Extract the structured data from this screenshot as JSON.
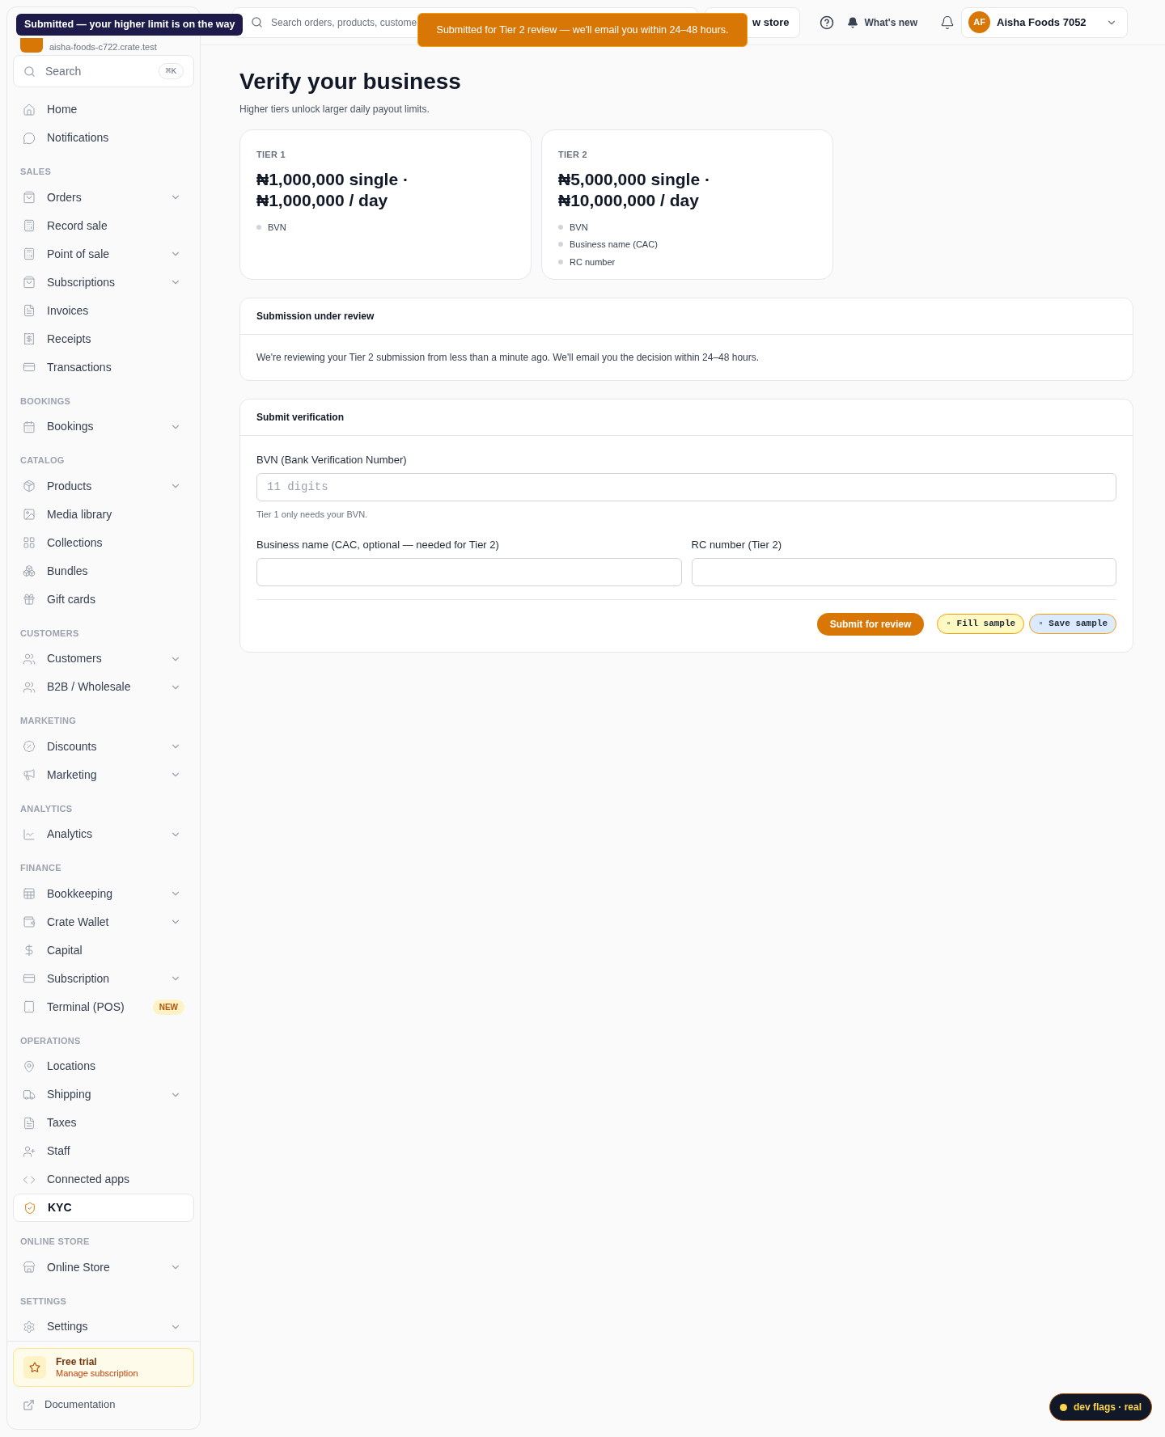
{
  "sidebar": {
    "store_url": "aisha-foods-c722.crate.test",
    "search": {
      "placeholder": "Search",
      "shortcut": "⌘K"
    },
    "sections": [
      {
        "items": [
          {
            "label": "Home",
            "expandable": false,
            "selected": false
          },
          {
            "label": "Notifications",
            "expandable": false,
            "selected": false
          }
        ]
      },
      {
        "title": "SALES",
        "items": [
          {
            "label": "Orders",
            "expandable": true,
            "selected": false
          },
          {
            "label": "Record sale",
            "expandable": false,
            "selected": false
          },
          {
            "label": "Point of sale",
            "expandable": true,
            "selected": false
          },
          {
            "label": "Subscriptions",
            "expandable": true,
            "selected": false
          },
          {
            "label": "Invoices",
            "expandable": false,
            "selected": false
          },
          {
            "label": "Receipts",
            "expandable": false,
            "selected": false
          },
          {
            "label": "Transactions",
            "expandable": false,
            "selected": false
          }
        ]
      },
      {
        "title": "BOOKINGS",
        "items": [
          {
            "label": "Bookings",
            "expandable": true,
            "selected": false
          }
        ]
      },
      {
        "title": "CATALOG",
        "items": [
          {
            "label": "Products",
            "expandable": true,
            "selected": false
          },
          {
            "label": "Media library",
            "expandable": false,
            "selected": false
          },
          {
            "label": "Collections",
            "expandable": false,
            "selected": false
          },
          {
            "label": "Bundles",
            "expandable": false,
            "selected": false
          },
          {
            "label": "Gift cards",
            "expandable": false,
            "selected": false
          }
        ]
      },
      {
        "title": "CUSTOMERS",
        "items": [
          {
            "label": "Customers",
            "expandable": true,
            "selected": false
          },
          {
            "label": "B2B / Wholesale",
            "expandable": true,
            "selected": false
          }
        ]
      },
      {
        "title": "MARKETING",
        "items": [
          {
            "label": "Discounts",
            "expandable": true,
            "selected": false
          },
          {
            "label": "Marketing",
            "expandable": true,
            "selected": false
          }
        ]
      },
      {
        "title": "ANALYTICS",
        "items": [
          {
            "label": "Analytics",
            "expandable": true,
            "selected": false
          }
        ]
      },
      {
        "title": "FINANCE",
        "items": [
          {
            "label": "Bookkeeping",
            "expandable": true,
            "selected": false
          },
          {
            "label": "Crate Wallet",
            "expandable": true,
            "selected": false
          },
          {
            "label": "Capital",
            "expandable": false,
            "selected": false
          },
          {
            "label": "Subscription",
            "expandable": true,
            "selected": false
          },
          {
            "label": "Terminal (POS)",
            "expandable": false,
            "selected": false,
            "badge": "NEW"
          }
        ]
      },
      {
        "title": "OPERATIONS",
        "items": [
          {
            "label": "Locations",
            "expandable": false,
            "selected": false
          },
          {
            "label": "Shipping",
            "expandable": true,
            "selected": false
          },
          {
            "label": "Taxes",
            "expandable": false,
            "selected": false
          },
          {
            "label": "Staff",
            "expandable": false,
            "selected": false
          },
          {
            "label": "Connected apps",
            "expandable": false,
            "selected": false
          },
          {
            "label": "KYC",
            "expandable": false,
            "selected": true
          }
        ]
      },
      {
        "title": "ONLINE STORE",
        "items": [
          {
            "label": "Online Store",
            "expandable": true,
            "selected": false
          }
        ]
      },
      {
        "title": "SETTINGS",
        "items": [
          {
            "label": "Settings",
            "expandable": true,
            "selected": false
          }
        ]
      }
    ],
    "trial": {
      "title": "Free trial",
      "link": "Manage subscription"
    },
    "documentation": "Documentation"
  },
  "toasts": [
    {
      "kind": "dark",
      "text": "Submitted — your higher limit is on the way"
    },
    {
      "kind": "orange",
      "text": "Submitted for Tier 2 review — we'll email you within 24–48 hours."
    }
  ],
  "header": {
    "search_placeholder": "Search orders, products, custome",
    "view_store": "w store",
    "whats_new": "What's new",
    "account": {
      "initials": "AF",
      "name": "Aisha Foods 7052"
    }
  },
  "page": {
    "title": "Verify your business",
    "subtitle": "Higher tiers unlock larger daily payout limits."
  },
  "tiers": [
    {
      "label": "TIER 1",
      "limits": "₦1,000,000 single · ₦1,000,000 / day",
      "requirements": [
        "BVN"
      ]
    },
    {
      "label": "TIER 2",
      "limits": "₦5,000,000 single · ₦10,000,000 / day",
      "requirements": [
        "BVN",
        "Business name (CAC)",
        "RC number"
      ]
    }
  ],
  "review": {
    "title": "Submission under review",
    "text": "We're reviewing your Tier 2 submission from less than a minute ago. We'll email you the decision within 24–48 hours."
  },
  "form": {
    "title": "Submit verification",
    "bvn": {
      "label": "BVN (Bank Verification Number)",
      "placeholder": "11 digits",
      "hint": "Tier 1 only needs your BVN."
    },
    "business_name": {
      "label": "Business name (CAC, optional — needed for Tier 2)"
    },
    "rc_number": {
      "label": "RC number (Tier 2)"
    },
    "submit": "Submit for review",
    "sample_buttons": [
      {
        "kind": "fill",
        "label": "▫ Fill sample"
      },
      {
        "kind": "save",
        "label": "▫ Save sample"
      }
    ]
  },
  "dev_flags": "dev flags · real"
}
